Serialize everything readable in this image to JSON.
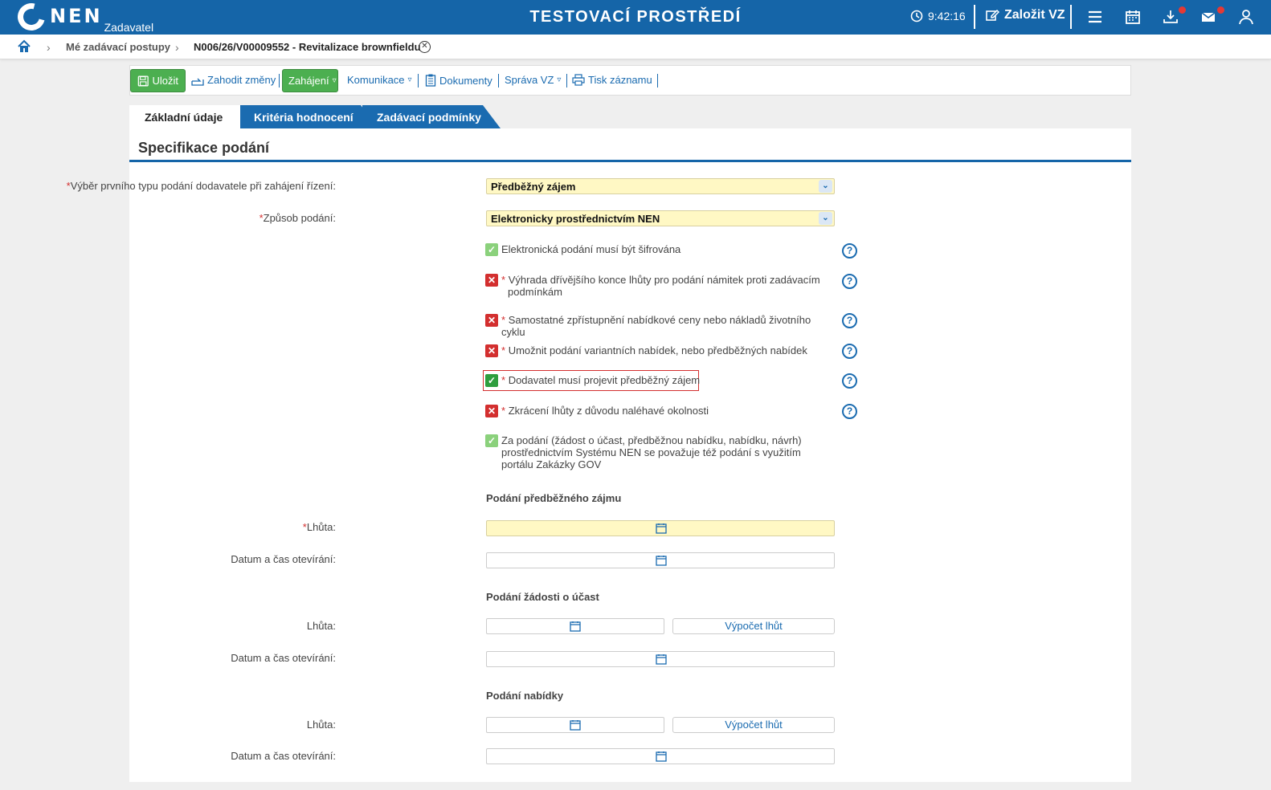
{
  "header": {
    "logo": "NEN",
    "logo_sub": "Zadavatel",
    "env_title": "TESTOVACÍ PROSTŘEDÍ",
    "clock": "9:42:16",
    "create_label": "Založit VZ"
  },
  "breadcrumb": {
    "item1": "Mé zadávací postupy",
    "item2": "N006/26/V00009552 - Revitalizace brownfieldu"
  },
  "toolbar": {
    "save": "Uložit",
    "discard": "Zahodit změny",
    "start": "Zahájení",
    "communication": "Komunikace",
    "documents": "Dokumenty",
    "admin": "Správa VZ",
    "print": "Tisk záznamu"
  },
  "tabs": [
    "Základní údaje",
    "Kritéria hodnocení",
    "Zadávací podmínky"
  ],
  "panel": {
    "title": "Specifikace podání",
    "field_first_type": "Výběr prvního typu podání dodavatele při zahájení řízení:",
    "value_first_type": "Předběžný zájem",
    "field_method": "Způsob podání:",
    "value_method": "Elektronicky prostřednictvím NEN",
    "checks": [
      {
        "state": "ok",
        "required": false,
        "text": "Elektronická podání musí být šifrována"
      },
      {
        "state": "x",
        "required": true,
        "text": "Výhrada dřívějšího konce lhůty pro podání námitek proti zadávacím podmínkám"
      },
      {
        "state": "x",
        "required": true,
        "text": "Samostatné zpřístupnění nabídkové ceny nebo nákladů životního cyklu"
      },
      {
        "state": "x",
        "required": true,
        "text": "Umožnit podání variantních nabídek, nebo předběžných nabídek"
      },
      {
        "state": "checked",
        "required": true,
        "text": "Dodavatel musí projevit předběžný zájem"
      },
      {
        "state": "x",
        "required": true,
        "text": "Zkrácení lhůty z důvodu naléhavé okolnosti"
      },
      {
        "state": "ok",
        "required": false,
        "text": "Za podání (žádost o účast, předběžnou nabídku, nabídku, návrh) prostřednictvím Systému NEN se považuje též podání s využitím portálu Zakázky GOV"
      }
    ],
    "star": "*",
    "section_interest": "Podání předběžného zájmu",
    "section_participation": "Podání žádosti o účast",
    "section_offer": "Podání nabídky",
    "label_deadline": "Lhůta:",
    "label_opening": "Datum a čas otevírání:",
    "calc_button": "Výpočet lhůt"
  },
  "colors": {
    "brand": "#1565a8",
    "green": "#4caf50",
    "required": "#d32f2f",
    "yellow": "#fff8c4"
  }
}
